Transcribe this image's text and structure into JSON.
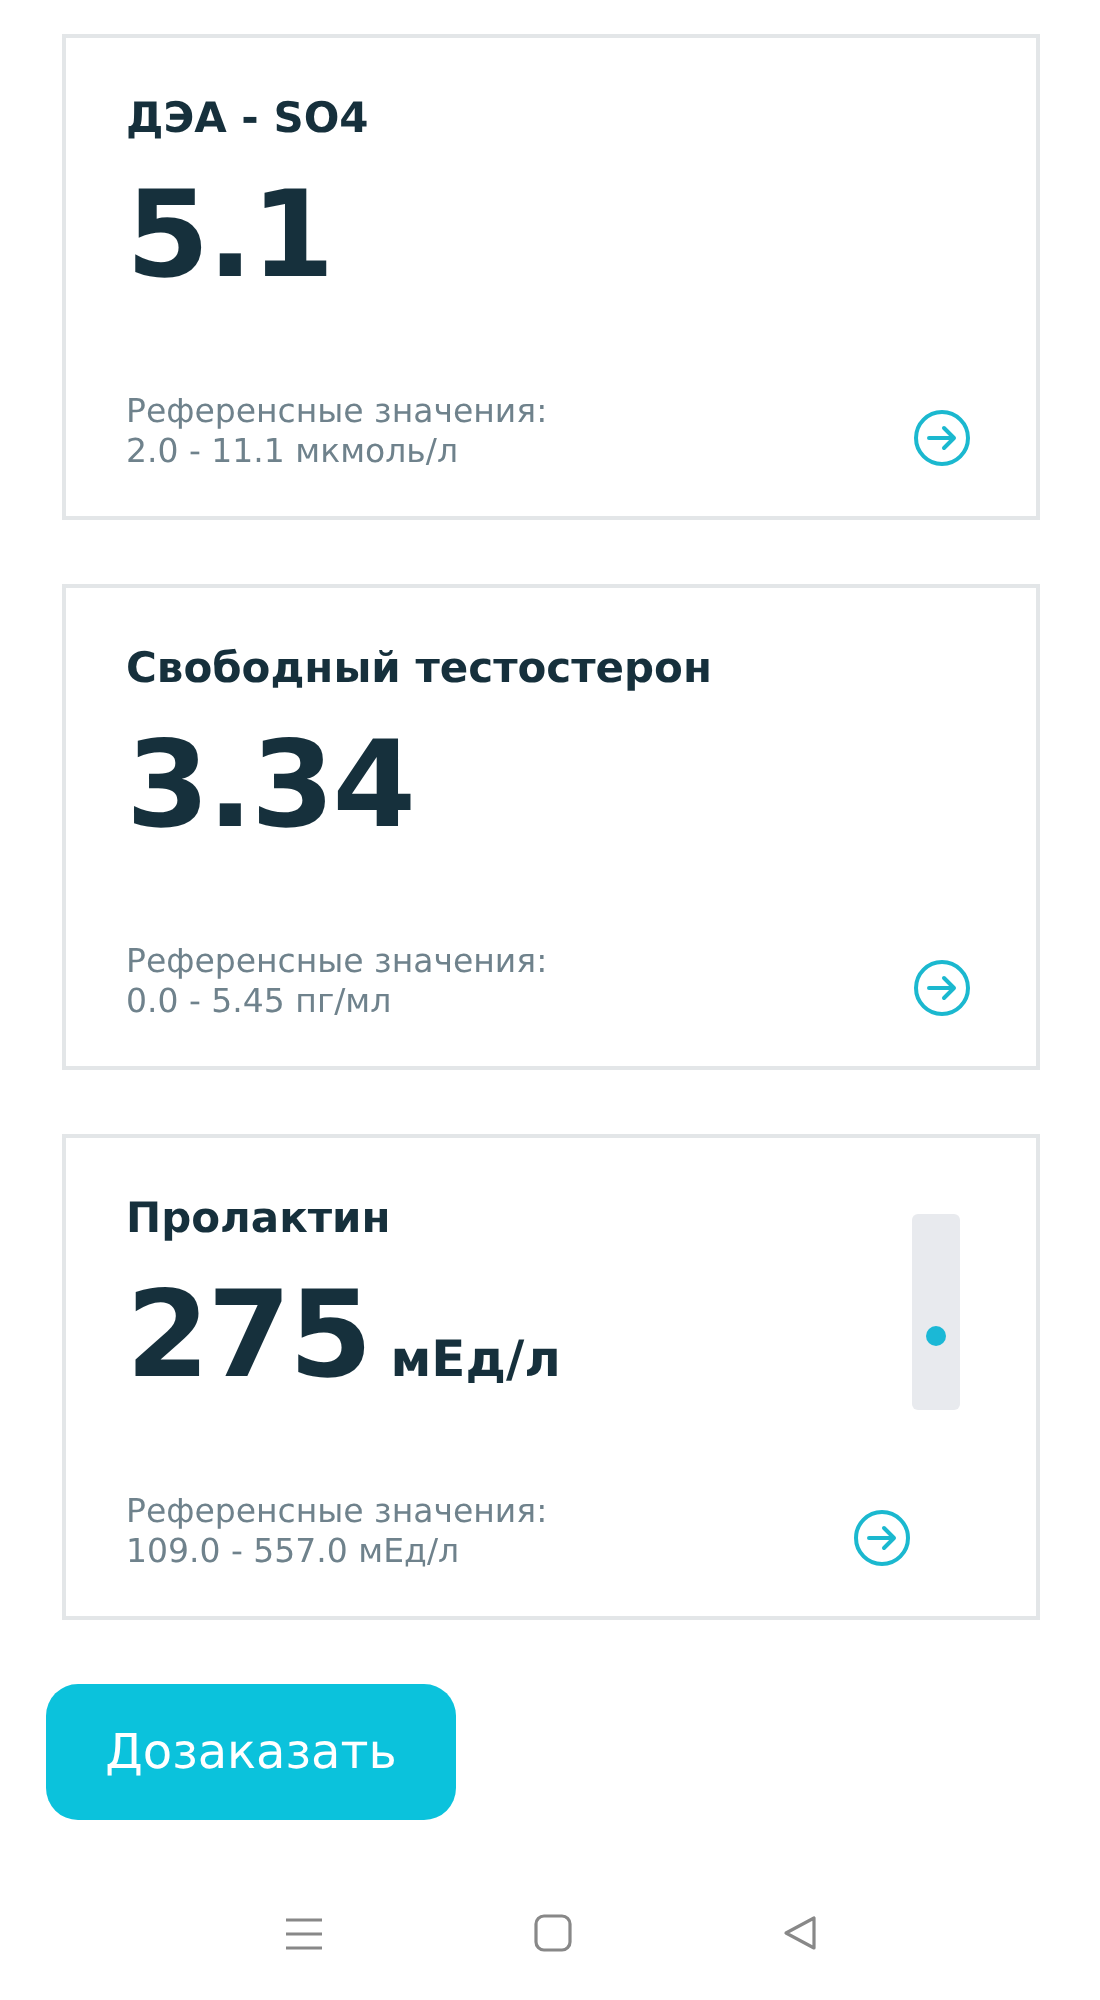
{
  "cards": [
    {
      "title": "ДЭА - SO4",
      "value": "5.1",
      "reference_label": "Референсные значения:",
      "reference_range": "2.0 - 11.1 мкмоль/л"
    },
    {
      "title": "Свободный тестостерон",
      "value": "3.34",
      "reference_label": "Референсные значения:",
      "reference_range": "0.0 - 5.45 пг/мл"
    },
    {
      "title": "Пролактин",
      "value": "275",
      "unit": "мЕд/л",
      "indicator": {
        "level": 0.38
      },
      "reference_label": "Референсные значения:",
      "reference_range": "109.0 - 557.0 мЕд/л"
    }
  ],
  "button": "Дозаказать"
}
